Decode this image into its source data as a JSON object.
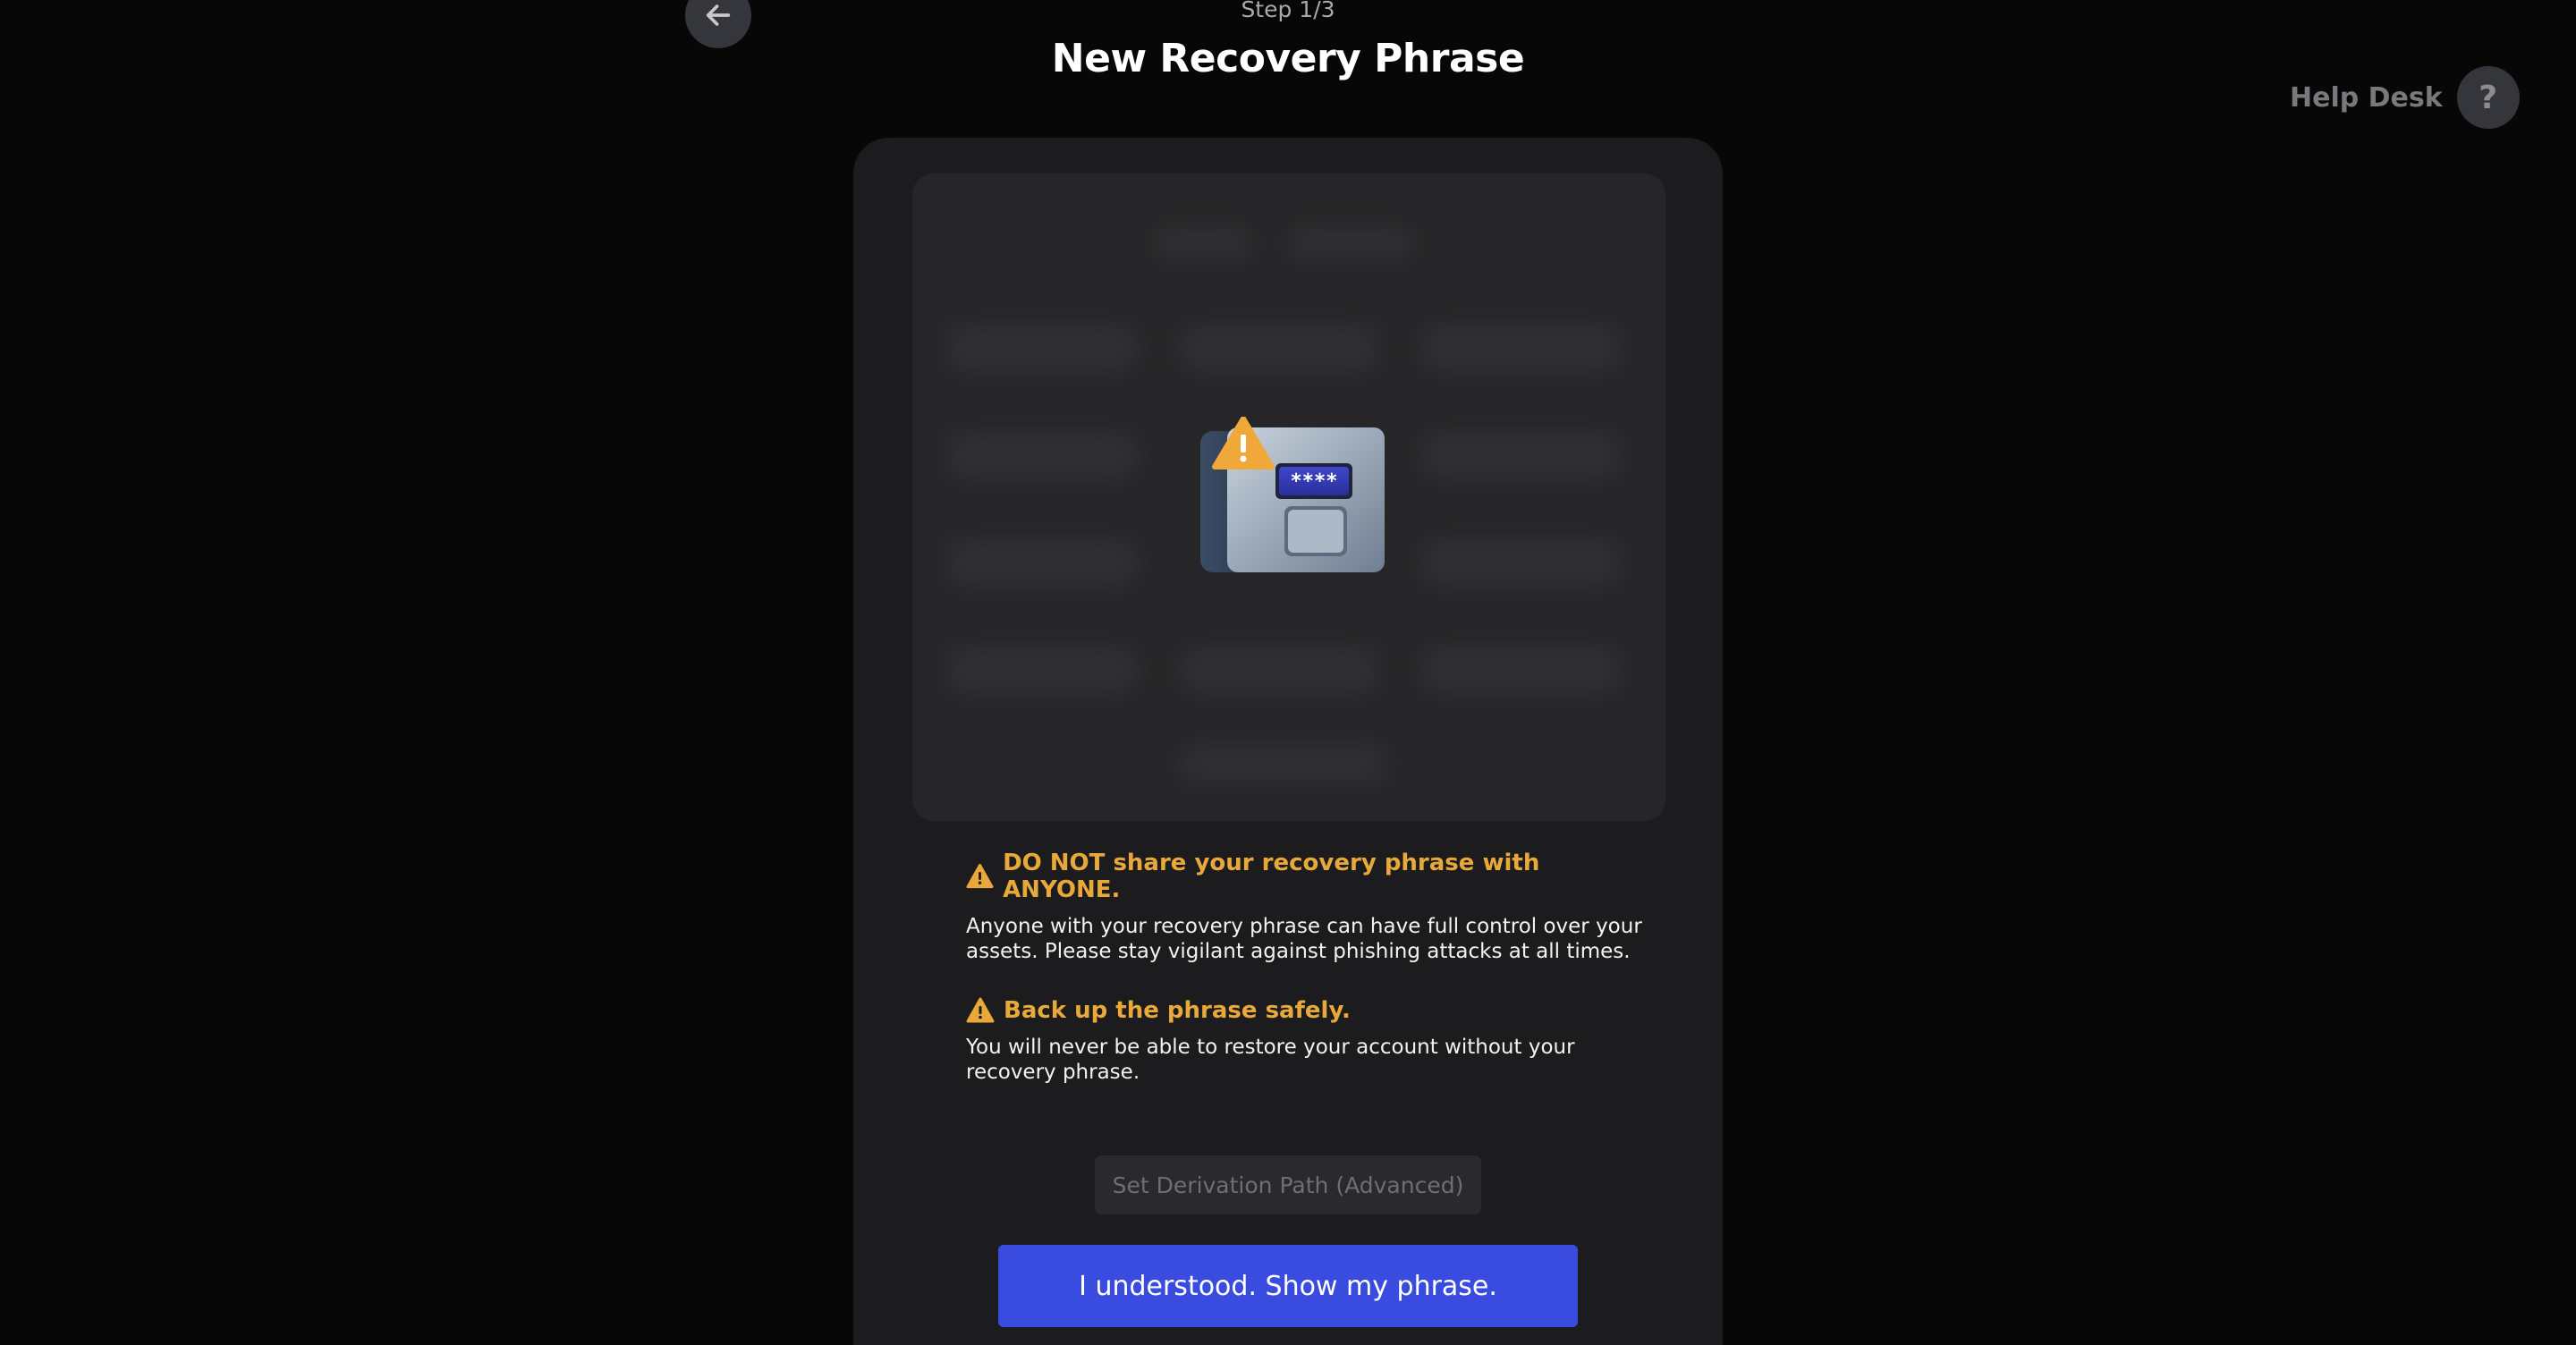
{
  "header": {
    "step": "Step 1/3",
    "title": "New Recovery Phrase",
    "help_desk_label": "Help Desk",
    "help_icon_glyph": "?"
  },
  "icons": {
    "back": "arrow-left-icon",
    "help": "question-mark-icon",
    "warning": "warning-triangle-icon",
    "illustration": "safe-with-password-icon"
  },
  "illustration": {
    "password_mask": "****"
  },
  "warnings": [
    {
      "title": "DO NOT share your recovery phrase with ANYONE.",
      "body": "Anyone with your recovery phrase can have full control over your assets. Please stay vigilant against phishing attacks at all times."
    },
    {
      "title": "Back up the phrase safely.",
      "body": "You will never be able to restore your account without your recovery phrase."
    }
  ],
  "buttons": {
    "derivation_path": "Set Derivation Path (Advanced)",
    "show_phrase": "I understood. Show my phrase."
  },
  "colors": {
    "background": "#070707",
    "card": "#1c1c1e",
    "warning": "#e8a93a",
    "primary": "#3a4bdf"
  }
}
